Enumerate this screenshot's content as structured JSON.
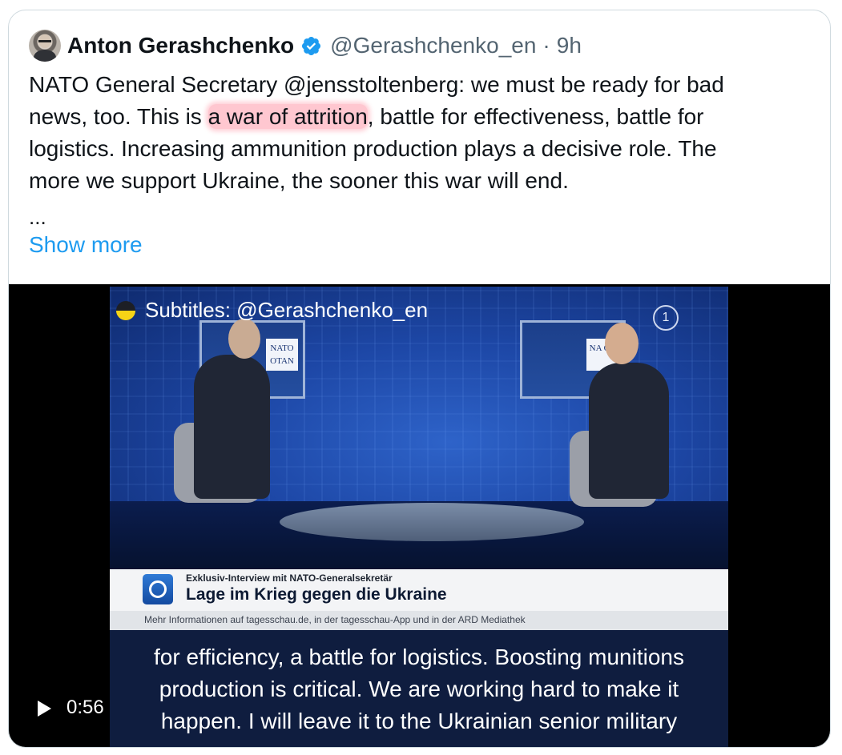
{
  "tweet": {
    "author_name": "Anton Gerashchenko",
    "handle": "@Gerashchenko_en",
    "separator": "·",
    "time": "9h",
    "lines": [
      "NATO General Secretary @jensstoltenberg: we must be ready for bad",
      "logistics. Increasing ammunition production plays a decisive role. The",
      "more we support Ukraine, the sooner this war will end."
    ],
    "line2_before": "news, too. This is ",
    "line2_highlight": "a war of attrition",
    "line2_after": ", battle for effectiveness, battle for",
    "ellipsis": "...",
    "show_more": "Show more"
  },
  "video": {
    "subtitle_tag": "Subtitles: @Gerashchenko_en",
    "screen_left_text": "NATO OTAN",
    "screen_right_text": "NA OT",
    "lower_third_kicker": "Exklusiv-Interview mit NATO-Generalsekretär",
    "lower_third_title": "Lage im Krieg gegen die Ukraine",
    "lower_third_info": "Mehr Informationen auf tagesschau.de, in der tagesschau-App und in der ARD Mediathek",
    "channel_logo": "1",
    "caption_lines": [
      "for efficiency, a battle for logistics. Boosting munitions",
      "production is critical. We are working hard to make it",
      "happen. I will leave it to the Ukrainian senior military"
    ],
    "duration": "0:56"
  },
  "colors": {
    "link": "#1d9bf0",
    "text": "#0f1419",
    "muted": "#536471",
    "highlight": "#ff5f78",
    "verified": "#1d9bf0"
  }
}
